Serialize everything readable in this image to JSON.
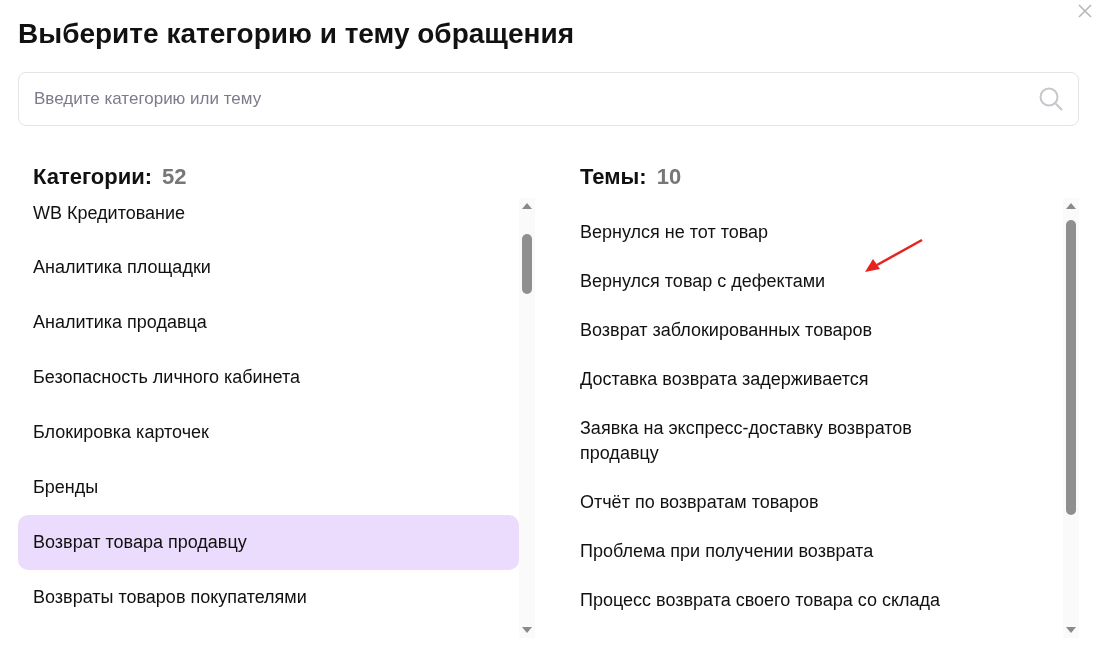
{
  "dialog": {
    "title": "Выберите категорию и тему обращения"
  },
  "search": {
    "placeholder": "Введите категорию или тему"
  },
  "categories": {
    "label": "Категории:",
    "count": "52",
    "items": [
      {
        "label": "WB Кредитование",
        "selected": false
      },
      {
        "label": "Аналитика площадки",
        "selected": false
      },
      {
        "label": "Аналитика продавца",
        "selected": false
      },
      {
        "label": "Безопасность личного кабинета",
        "selected": false
      },
      {
        "label": "Блокировка карточек",
        "selected": false
      },
      {
        "label": "Бренды",
        "selected": false
      },
      {
        "label": "Возврат товара продавцу",
        "selected": true
      },
      {
        "label": "Возвраты товаров покупателями",
        "selected": false
      }
    ]
  },
  "topics": {
    "label": "Темы:",
    "count": "10",
    "items": [
      {
        "label": "Вернулся не тот товар"
      },
      {
        "label": "Вернулся товар с дефектами"
      },
      {
        "label": "Возврат заблокированных товаров"
      },
      {
        "label": "Доставка возврата задерживается"
      },
      {
        "label": "Заявка на экспресс-доставку возвратов продавцу"
      },
      {
        "label": "Отчёт по возвратам товаров"
      },
      {
        "label": "Проблема при получении возврата"
      },
      {
        "label": "Процесс возврата своего товара со склада"
      }
    ]
  }
}
